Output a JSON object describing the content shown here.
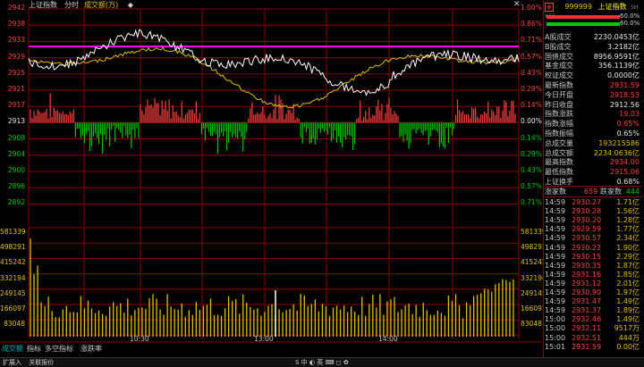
{
  "header": {
    "index_name": "上证指数",
    "mode": "分时",
    "volume_label": "成交额(万)"
  },
  "price_axis_left": [
    "2942",
    "2938",
    "2933",
    "2929",
    "2925",
    "2921",
    "2917",
    "2913",
    "2908",
    "2904",
    "2900",
    "2896",
    "2892"
  ],
  "price_axis_right": [
    "1.00%",
    "0.86%",
    "0.71%",
    "0.57%",
    "0.43%",
    "0.29%",
    "0.14%",
    "0.00%",
    "0.14%",
    "0.29%",
    "0.43%",
    "0.57%",
    "0.71%"
  ],
  "volume_axis_left": [
    "581339",
    "498291",
    "415242",
    "332194",
    "249145",
    "166097",
    "83048"
  ],
  "volume_axis_right": [
    "581339",
    "498291",
    "415242",
    "332194",
    "249145",
    "166097",
    "83048"
  ],
  "time_labels": [
    "10:30",
    "13:00",
    "14:00"
  ],
  "bottom_tabs": [
    "成交额",
    "指标",
    "多空指标",
    "涨跌率"
  ],
  "status_bar": {
    "left_items": [
      "扩展入",
      "关联报价"
    ],
    "icons_text": "S 中 ◐ 英 ⌨ ◻ ✿"
  },
  "sidebar": {
    "code": "999999",
    "name": "上证指数",
    "sub": "SH X62",
    "bar_pcts": [
      "60.0%",
      "60.0%"
    ],
    "stats": [
      {
        "k": "A股成交",
        "v": "2230.0453亿",
        "c": "white"
      },
      {
        "k": "B股成交",
        "v": "3.2182亿",
        "c": "white"
      },
      {
        "k": "国债成交",
        "v": "8956.9591亿",
        "c": "white"
      },
      {
        "k": "基金成交",
        "v": "356.1139亿",
        "c": "white"
      },
      {
        "k": "权证成交",
        "v": "0.0000亿",
        "c": "white"
      },
      {
        "k": "最新指数",
        "v": "2931.59",
        "c": "red"
      },
      {
        "k": "今日开盘",
        "v": "2918.53",
        "c": "red"
      },
      {
        "k": "昨日收盘",
        "v": "2912.56",
        "c": "white"
      },
      {
        "k": "指数涨跌",
        "v": "19.03",
        "c": "red"
      },
      {
        "k": "指数涨幅",
        "v": "0.65%",
        "c": "red"
      },
      {
        "k": "指数振幅",
        "v": "0.65%",
        "c": "white"
      },
      {
        "k": "总成交量",
        "v": "193215586",
        "c": "yellow"
      },
      {
        "k": "总成交额",
        "v": "2234.0636亿",
        "c": "yellow"
      },
      {
        "k": "最高指数",
        "v": "2934.00",
        "c": "red"
      },
      {
        "k": "最低指数",
        "v": "2915.06",
        "c": "red"
      },
      {
        "k": "上证换手",
        "v": "0.68%",
        "c": "white"
      }
    ],
    "updown": {
      "up_label": "涨家数",
      "up": "659",
      "down_label": "跌家数",
      "down": "444"
    },
    "ticks": [
      {
        "t": "14:59",
        "p": "2930.27",
        "q": "1.71亿"
      },
      {
        "t": "14:59",
        "p": "2930.28",
        "q": "1.56亿"
      },
      {
        "t": "14:59",
        "p": "2930.20",
        "q": "1.28亿"
      },
      {
        "t": "14:59",
        "p": "2929.59",
        "q": "1.77亿"
      },
      {
        "t": "14:59",
        "p": "2930.57",
        "q": "2.34亿"
      },
      {
        "t": "14:59",
        "p": "2930.22",
        "q": "1.90亿"
      },
      {
        "t": "14:59",
        "p": "2930.15",
        "q": "2.29亿"
      },
      {
        "t": "14:59",
        "p": "2930.35",
        "q": "1.87亿"
      },
      {
        "t": "14:59",
        "p": "2931.16",
        "q": "1.85亿"
      },
      {
        "t": "14:59",
        "p": "2931.12",
        "q": "2.01亿"
      },
      {
        "t": "14:59",
        "p": "2930.90",
        "q": "1.97亿"
      },
      {
        "t": "14:59",
        "p": "2931.47",
        "q": "1.49亿"
      },
      {
        "t": "14:59",
        "p": "2931.37",
        "q": "1.89亿"
      },
      {
        "t": "15:00",
        "p": "2932.46",
        "q": "1.49亿"
      },
      {
        "t": "15:00",
        "p": "2932.11",
        "q": "9517万"
      },
      {
        "t": "15:00",
        "p": "2932.51",
        "q": "444万"
      },
      {
        "t": "15:01",
        "p": "2931.59",
        "q": "0.00亿"
      }
    ]
  },
  "colors": {
    "up": "#ff4040",
    "down": "#00c800",
    "price_line": "#ffffff",
    "avg_line": "#e0c000",
    "ref_line": "#ff00ff",
    "grid": "#8b0000"
  }
}
